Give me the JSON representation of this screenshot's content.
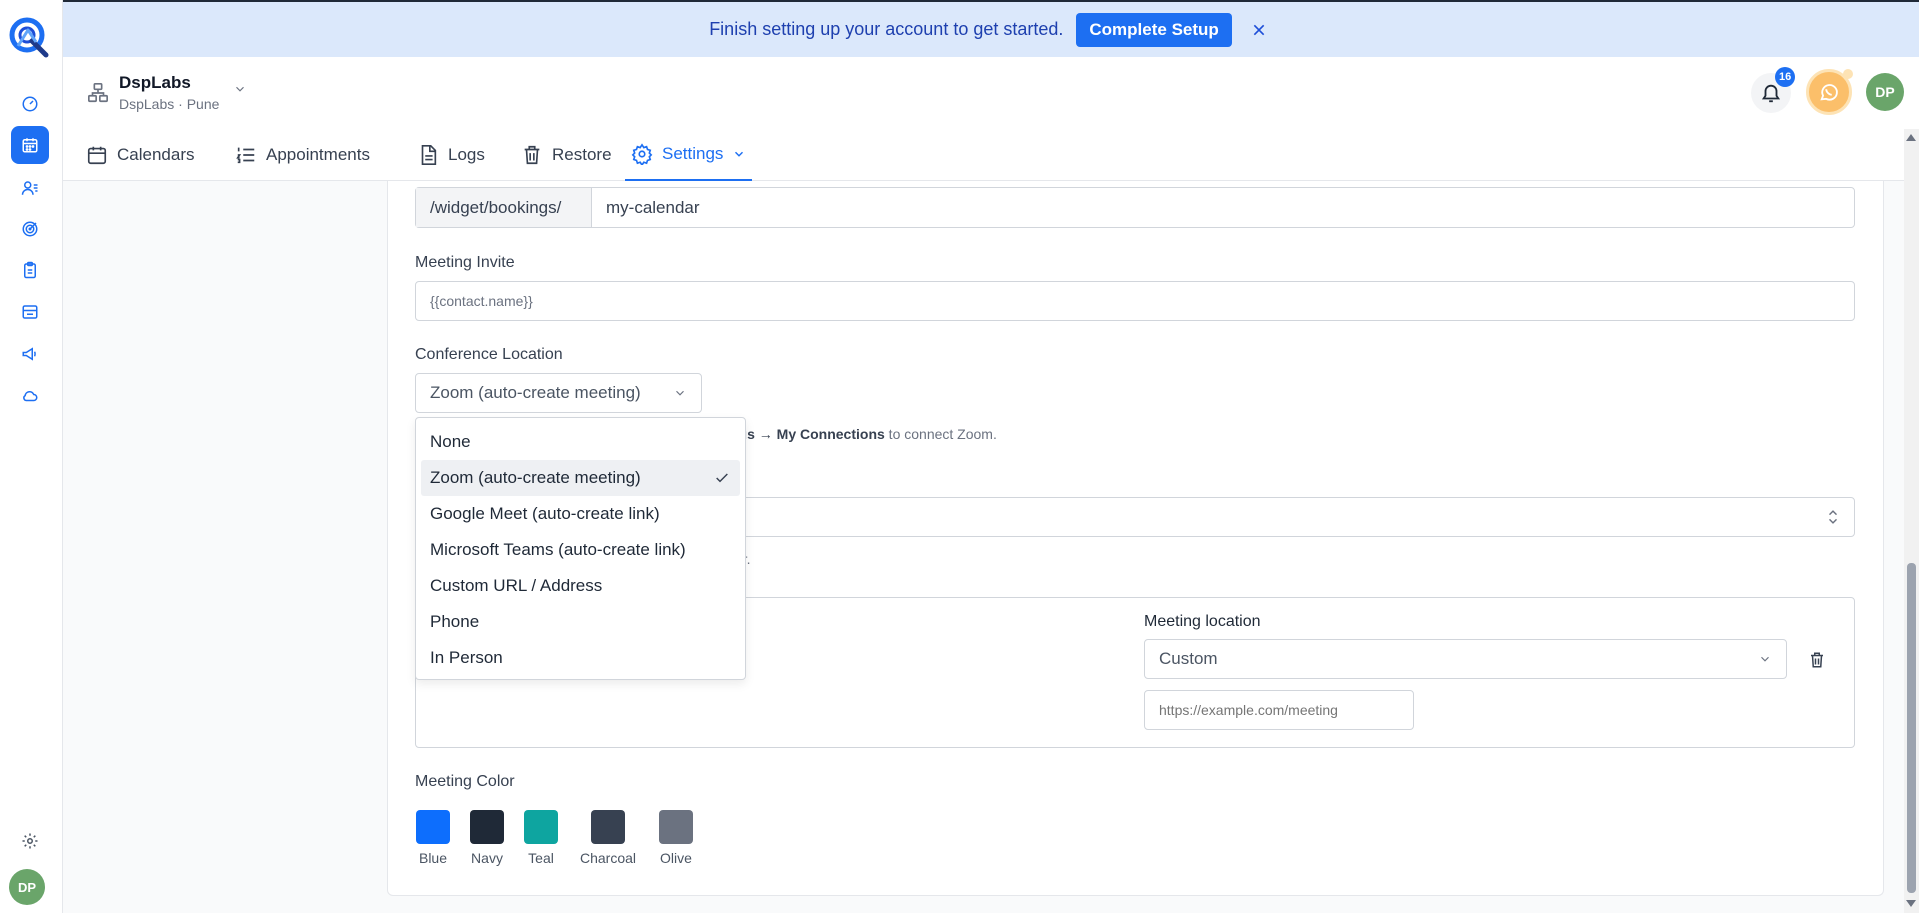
{
  "banner": {
    "message": "Finish setting up your account to get started.",
    "button": "Complete Setup"
  },
  "header": {
    "org_name": "DspLabs",
    "org_sub": "DspLabs · Pune",
    "notifications_count": "16",
    "avatar_initials": "DP"
  },
  "rail": {
    "avatar_initials": "DP"
  },
  "tabs": [
    {
      "label": "Calendars"
    },
    {
      "label": "Appointments"
    },
    {
      "label": "Logs"
    },
    {
      "label": "Restore"
    },
    {
      "label": "Settings"
    }
  ],
  "form": {
    "booking_prefix": "/widget/bookings/",
    "booking_slug": "my-calendar",
    "meeting_invite_label": "Meeting Invite",
    "meeting_invite_value": "{{contact.name}}",
    "conference_label": "Conference Location",
    "conference_value": "Zoom (auto-create meeting)",
    "hint_frag1": "ngs",
    "hint_arrow": " → ",
    "hint_bold2": "My Connections",
    "hint_frag2": " to connect Zoom.",
    "hint2_frag": "er.",
    "meeting_location_label": "Meeting location",
    "meeting_location_value": "Custom",
    "meeting_url_placeholder": "https://example.com/meeting",
    "meeting_color_label": "Meeting Color"
  },
  "colors": [
    {
      "name": "Blue",
      "hex": "#0d6efd"
    },
    {
      "name": "Navy",
      "hex": "#1f2937"
    },
    {
      "name": "Teal",
      "hex": "#0ea5a0"
    },
    {
      "name": "Charcoal",
      "hex": "#374151"
    },
    {
      "name": "Olive",
      "hex": "#6b7280"
    }
  ],
  "dropdown_options": [
    {
      "label": "None"
    },
    {
      "label": "Zoom (auto-create meeting)",
      "selected": true
    },
    {
      "label": "Google Meet (auto-create link)"
    },
    {
      "label": "Microsoft Teams (auto-create link)"
    },
    {
      "label": "Custom URL / Address"
    },
    {
      "label": "Phone"
    },
    {
      "label": "In Person"
    }
  ],
  "accent_color": "#1d6ff2"
}
